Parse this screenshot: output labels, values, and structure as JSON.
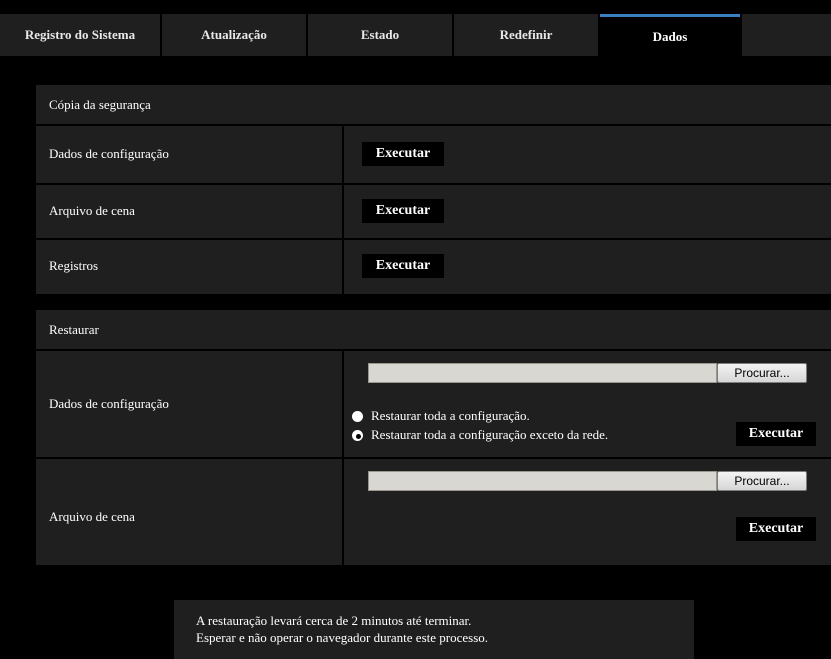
{
  "tabs": [
    {
      "label": "Registro do Sistema"
    },
    {
      "label": "Atualização"
    },
    {
      "label": "Estado"
    },
    {
      "label": "Redefinir"
    },
    {
      "label": "Dados",
      "active": true
    }
  ],
  "backup": {
    "title": "Cópia da segurança",
    "rows": [
      {
        "label": "Dados de configuração",
        "button": "Executar"
      },
      {
        "label": "Arquivo de cena",
        "button": "Executar"
      },
      {
        "label": "Registros",
        "button": "Executar"
      }
    ]
  },
  "restore": {
    "title": "Restaurar",
    "config": {
      "label": "Dados de configuração",
      "file_value": "",
      "browse": "Procurar...",
      "options": [
        {
          "label": "Restaurar toda a configuração.",
          "selected": false
        },
        {
          "label": "Restaurar toda a configuração exceto da rede.",
          "selected": true
        }
      ],
      "button": "Executar"
    },
    "scene": {
      "label": "Arquivo de cena",
      "file_value": "",
      "browse": "Procurar...",
      "button": "Executar"
    }
  },
  "notice": {
    "line1": "A restauração levará cerca de 2 minutos até terminar.",
    "line2": "Esperar e não operar o navegador durante este processo."
  }
}
